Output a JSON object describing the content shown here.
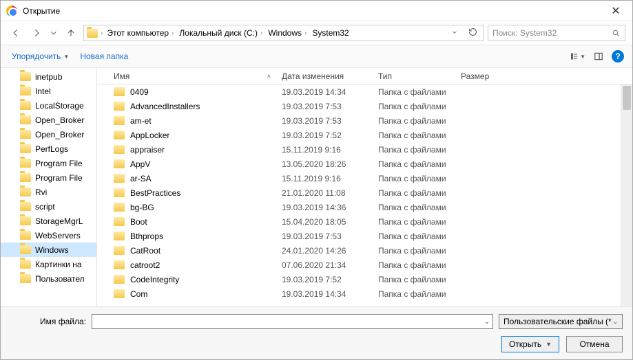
{
  "window": {
    "title": "Открытие",
    "close": "✕"
  },
  "nav": {
    "back": "←",
    "forward": "→",
    "up": "↑"
  },
  "breadcrumbs": [
    "Этот компьютер",
    "Локальный диск (C:)",
    "Windows",
    "System32"
  ],
  "search": {
    "placeholder": "Поиск: System32"
  },
  "toolbar": {
    "organize": "Упорядочить",
    "new_folder": "Новая папка"
  },
  "columns": {
    "name": "Имя",
    "date": "Дата изменения",
    "type": "Тип",
    "size": "Размер"
  },
  "sidebar": {
    "items": [
      {
        "label": "inetpub",
        "selected": false
      },
      {
        "label": "Intel",
        "selected": false
      },
      {
        "label": "LocalStorage",
        "selected": false
      },
      {
        "label": "Open_Broker",
        "selected": false
      },
      {
        "label": "Open_Broker",
        "selected": false
      },
      {
        "label": "PerfLogs",
        "selected": false
      },
      {
        "label": "Program File",
        "selected": false
      },
      {
        "label": "Program File",
        "selected": false
      },
      {
        "label": "Rvi",
        "selected": false
      },
      {
        "label": "script",
        "selected": false
      },
      {
        "label": "StorageMgrL",
        "selected": false
      },
      {
        "label": "WebServers",
        "selected": false
      },
      {
        "label": "Windows",
        "selected": true
      },
      {
        "label": "Картинки на",
        "selected": false
      },
      {
        "label": "Пользовател",
        "selected": false
      }
    ]
  },
  "files": [
    {
      "name": "0409",
      "date": "19.03.2019 14:34",
      "type": "Папка с файлами",
      "size": ""
    },
    {
      "name": "AdvancedInstallers",
      "date": "19.03.2019 7:53",
      "type": "Папка с файлами",
      "size": ""
    },
    {
      "name": "am-et",
      "date": "19.03.2019 7:53",
      "type": "Папка с файлами",
      "size": ""
    },
    {
      "name": "AppLocker",
      "date": "19.03.2019 7:52",
      "type": "Папка с файлами",
      "size": ""
    },
    {
      "name": "appraiser",
      "date": "15.11.2019 9:16",
      "type": "Папка с файлами",
      "size": ""
    },
    {
      "name": "AppV",
      "date": "13.05.2020 18:26",
      "type": "Папка с файлами",
      "size": ""
    },
    {
      "name": "ar-SA",
      "date": "15.11.2019 9:16",
      "type": "Папка с файлами",
      "size": ""
    },
    {
      "name": "BestPractices",
      "date": "21.01.2020 11:08",
      "type": "Папка с файлами",
      "size": ""
    },
    {
      "name": "bg-BG",
      "date": "19.03.2019 14:36",
      "type": "Папка с файлами",
      "size": ""
    },
    {
      "name": "Boot",
      "date": "15.04.2020 18:05",
      "type": "Папка с файлами",
      "size": ""
    },
    {
      "name": "Bthprops",
      "date": "19.03.2019 7:53",
      "type": "Папка с файлами",
      "size": ""
    },
    {
      "name": "CatRoot",
      "date": "24.01.2020 14:26",
      "type": "Папка с файлами",
      "size": ""
    },
    {
      "name": "catroot2",
      "date": "07.06.2020 21:34",
      "type": "Папка с файлами",
      "size": ""
    },
    {
      "name": "CodeIntegrity",
      "date": "19.03.2019 7:52",
      "type": "Папка с файлами",
      "size": ""
    },
    {
      "name": "Com",
      "date": "19.03.2019 14:34",
      "type": "Папка с файлами",
      "size": ""
    }
  ],
  "footer": {
    "filename_label": "Имя файла:",
    "filename_value": "",
    "filter_label": "Пользовательские файлы (*.jp",
    "open": "Открыть",
    "cancel": "Отмена"
  }
}
